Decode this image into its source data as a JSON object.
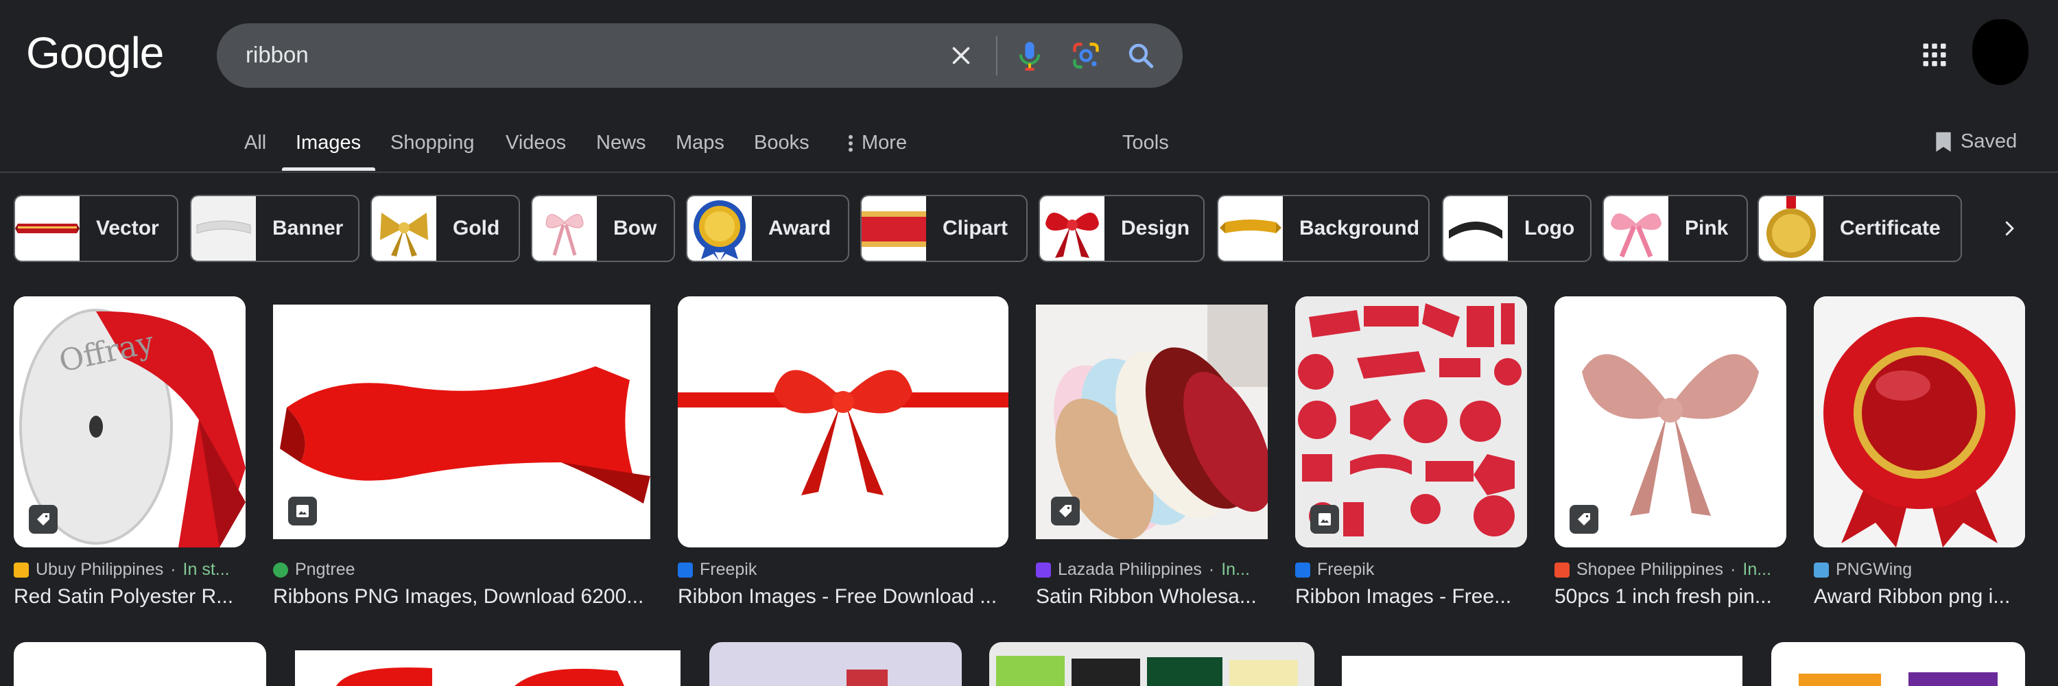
{
  "header": {
    "logo": "Google",
    "search": {
      "query": "ribbon"
    },
    "saved_label": "Saved"
  },
  "tabs": [
    {
      "label": "All"
    },
    {
      "label": "Images",
      "active": true
    },
    {
      "label": "Shopping"
    },
    {
      "label": "Videos"
    },
    {
      "label": "News"
    },
    {
      "label": "Maps"
    },
    {
      "label": "Books"
    },
    {
      "label": "More"
    },
    {
      "label": "Tools"
    }
  ],
  "chips": [
    {
      "label": "Vector"
    },
    {
      "label": "Banner"
    },
    {
      "label": "Gold"
    },
    {
      "label": "Bow"
    },
    {
      "label": "Award"
    },
    {
      "label": "Clipart"
    },
    {
      "label": "Design"
    },
    {
      "label": "Background"
    },
    {
      "label": "Logo"
    },
    {
      "label": "Pink"
    },
    {
      "label": "Certificate"
    }
  ],
  "results": [
    {
      "source": "Ubuy Philippines",
      "stock": "In st...",
      "title": "Red Satin Polyester R...",
      "badge": "tag-icon"
    },
    {
      "source": "Pngtree",
      "stock": "",
      "title": "Ribbons PNG Images, Download 6200...",
      "badge": "image-icon"
    },
    {
      "source": "Freepik",
      "stock": "",
      "title": "Ribbon Images - Free Download ...",
      "badge": ""
    },
    {
      "source": "Lazada Philippines",
      "stock": "In...",
      "title": "Satin Ribbon Wholesa...",
      "badge": "tag-icon"
    },
    {
      "source": "Freepik",
      "stock": "",
      "title": "Ribbon Images - Free...",
      "badge": "image-icon"
    },
    {
      "source": "Shopee Philippines",
      "stock": "In...",
      "title": "50pcs 1 inch fresh pin...",
      "badge": "tag-icon"
    },
    {
      "source": "PNGWing",
      "stock": "",
      "title": "Award Ribbon png i...",
      "badge": ""
    }
  ],
  "colors": {
    "background": "#202124",
    "searchbar": "#4d5156",
    "in_stock": "#81c995"
  }
}
